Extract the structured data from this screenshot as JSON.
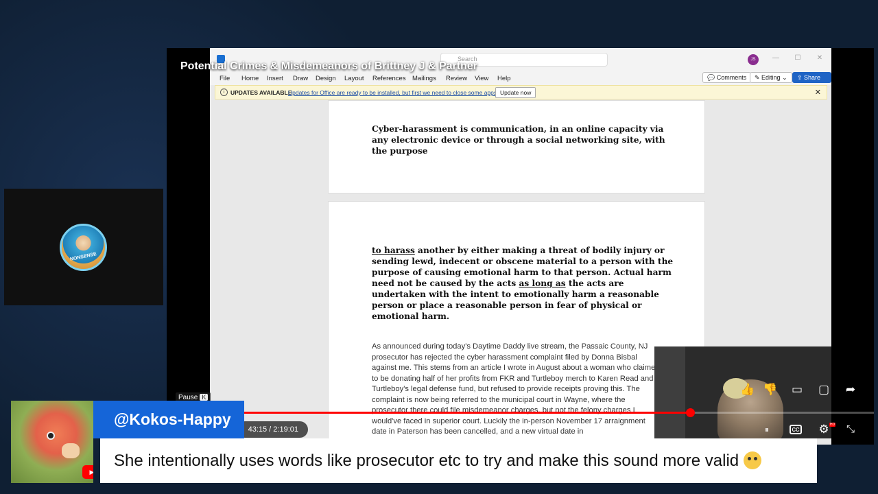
{
  "video": {
    "title": "Potential Crimes & Misdemeanors of Brittney J & Partner"
  },
  "channel": {
    "avatar_text": "NONSENSE"
  },
  "word": {
    "search_placeholder": "Search",
    "user_initials": "JS",
    "menu": [
      "File",
      "Home",
      "Insert",
      "Draw",
      "Design",
      "Layout",
      "References",
      "Mailings",
      "Review",
      "View",
      "Help"
    ],
    "comments_label": "Comments",
    "editing_label": "Editing",
    "share_label": "Share",
    "notification": {
      "title": "UPDATES AVAILABLE",
      "message": "Updates for Office are ready to be installed, but first we need to close some apps.",
      "button": "Update now"
    },
    "page1_text": "Cyber-harassment is communication, in an online capacity via any electronic device or through a social networking site, with the purpose",
    "page2": {
      "u1": "to harass",
      "t1": " another by either making a threat of bodily injury or sending lewd, indecent or obscene material to a person with the purpose of causing emotional harm to that person. Actual harm need not be caused by the acts ",
      "u2": "as long as",
      "t2": " the acts are undertaken with the intent to emotionally harm a reasonable person or place a reasonable person in fear of physical or emotional harm."
    },
    "article_text": "As announced during today's Daytime Daddy live stream, the Passaic County, NJ prosecutor has rejected the cyber harassment complaint filed by Donna Bisbal against me. This stems from an article I wrote in August about a woman who claimed to be donating half of her profits from FKR and Turtleboy merch to Karen Read and Turtleboy's legal defense fund, but refused to provide receipts proving this. The complaint is now being referred to the municipal court in Wayne, where the prosecutor there could file misdemeanor charges, but not the felony charges I would've faced in superior court. Luckily the in-person November 17 arraignment date in Paterson has been cancelled, and a new virtual date in"
  },
  "player": {
    "pause_label": "Pause",
    "pause_key": "K",
    "time": "43:15 / 2:19:01",
    "progress": 0.74,
    "hd_badge": "HD"
  },
  "chat": {
    "username": "@Kokos-Happy",
    "message": "She intentionally uses words like prosecutor etc to try and make this sound more valid"
  },
  "colors": {
    "accent_blue": "#1565d8",
    "progress_red": "#ff0000",
    "background": "#0f1f33"
  }
}
